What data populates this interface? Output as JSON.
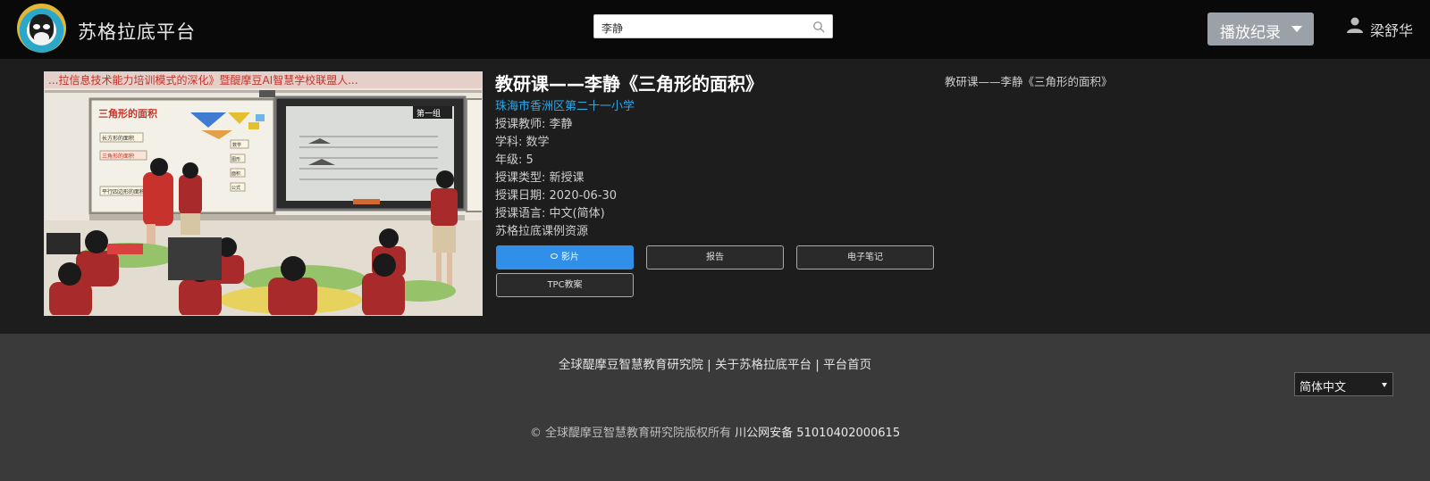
{
  "header": {
    "brand": "苏格拉底平台",
    "search_value": "李静",
    "play_record_label": "播放纪录",
    "user_name": "梁舒华"
  },
  "lesson": {
    "title": "教研课——李静《三角形的面积》",
    "school": "珠海市香洲区第二十一小学",
    "teacher": "授课教师: 李静",
    "subject": "学科: 数学",
    "grade": "年级: 5",
    "type": "授课类型: 新授课",
    "date": "授课日期: 2020-06-30",
    "language": "授课语言: 中文(简体)",
    "source": "苏格拉底课例资源",
    "side_title": "教研课——李静《三角形的面积》"
  },
  "thumbnail": {
    "banner_text": "...拉信息技术能力培训模式的深化》暨醍摩豆AI智慧学校联盟人...",
    "board_title": "三角形的面积",
    "board_items": [
      "长方形的面积",
      "三角形的面积",
      "平行四边形的面积"
    ],
    "board_right_items": [
      "数学",
      "图形",
      "面积",
      "公式"
    ],
    "screen_tag": "第一组"
  },
  "buttons": {
    "video": "影片",
    "report": "报告",
    "notes": "电子笔记",
    "tpc": "TPC教案"
  },
  "footer": {
    "link1": "全球醍摩豆智慧教育研究院",
    "sep": " | ",
    "link2": "关于苏格拉底平台",
    "link3": "平台首页",
    "language": "简体中文",
    "copyright": "© 全球醍摩豆智慧教育研究院版权所有",
    "registration": "川公网安备 51010402000615"
  },
  "colors": {
    "accent_blue": "#2f8fe9",
    "school_link": "#2ea6e6",
    "header_bg": "#090909",
    "band_bg": "#1d1d1d",
    "footer_bg": "#3a3a3a"
  }
}
